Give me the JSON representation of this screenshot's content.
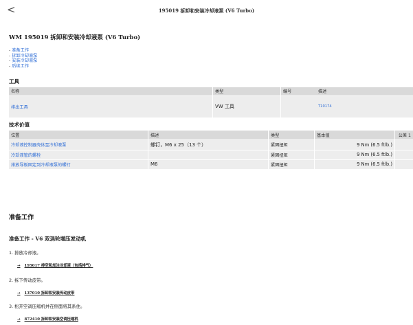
{
  "header": {
    "back_label": "<",
    "title": "195019 拆卸和安装冷却液泵 (V6 Turbo)"
  },
  "doc": {
    "title": "WM 195019 拆卸和安装冷却液泵 (V6 Turbo)",
    "toc": [
      "准备工作",
      "拆卸冷却液泵",
      "安装冷却液泵",
      "后续工作"
    ]
  },
  "tools": {
    "heading": "工具",
    "columns": [
      "名称",
      "类型",
      "编号",
      "描述"
    ],
    "rows": [
      {
        "name": "排出工具",
        "type": "VW 工具",
        "number": "",
        "desc": "T10174"
      }
    ]
  },
  "tech": {
    "heading": "技术价值",
    "columns": [
      "位置",
      "描述",
      "类型",
      "基本值",
      "公差 1"
    ],
    "rows": [
      {
        "position": "冷却液控制器壳体至冷却液泵",
        "desc": "螺钉，M6 x 25（13 个）",
        "type": "紧固扭矩",
        "value": "9 Nm (6.5 ftlb.)",
        "tol": ""
      },
      {
        "position": "冷却液管的螺栓",
        "desc": "",
        "type": "紧固扭矩",
        "value": "9 Nm (6.5 ftlb.)",
        "tol": ""
      },
      {
        "position": "排放导板固定到冷却液泵的螺钉",
        "desc": "M6",
        "type": "紧固扭矩",
        "value": "9 Nm (6.5 ftlb.)",
        "tol": ""
      }
    ]
  },
  "prep": {
    "heading": "准备工作",
    "subheading": "准备工作 - V6 双涡轮增压发动机",
    "steps": [
      {
        "text": "1. 排放冷却液。",
        "ref": "195017  排空和加注冷却液（包括排气）"
      },
      {
        "text": "2. 拆下传动皮带。",
        "ref": "137010  拆卸和安装传动皮带"
      },
      {
        "text": "3. 松开空调压缩机并在侧面将其系住。",
        "ref": "872410  拆卸和安装空调压缩机"
      }
    ],
    "arrow": "→"
  }
}
